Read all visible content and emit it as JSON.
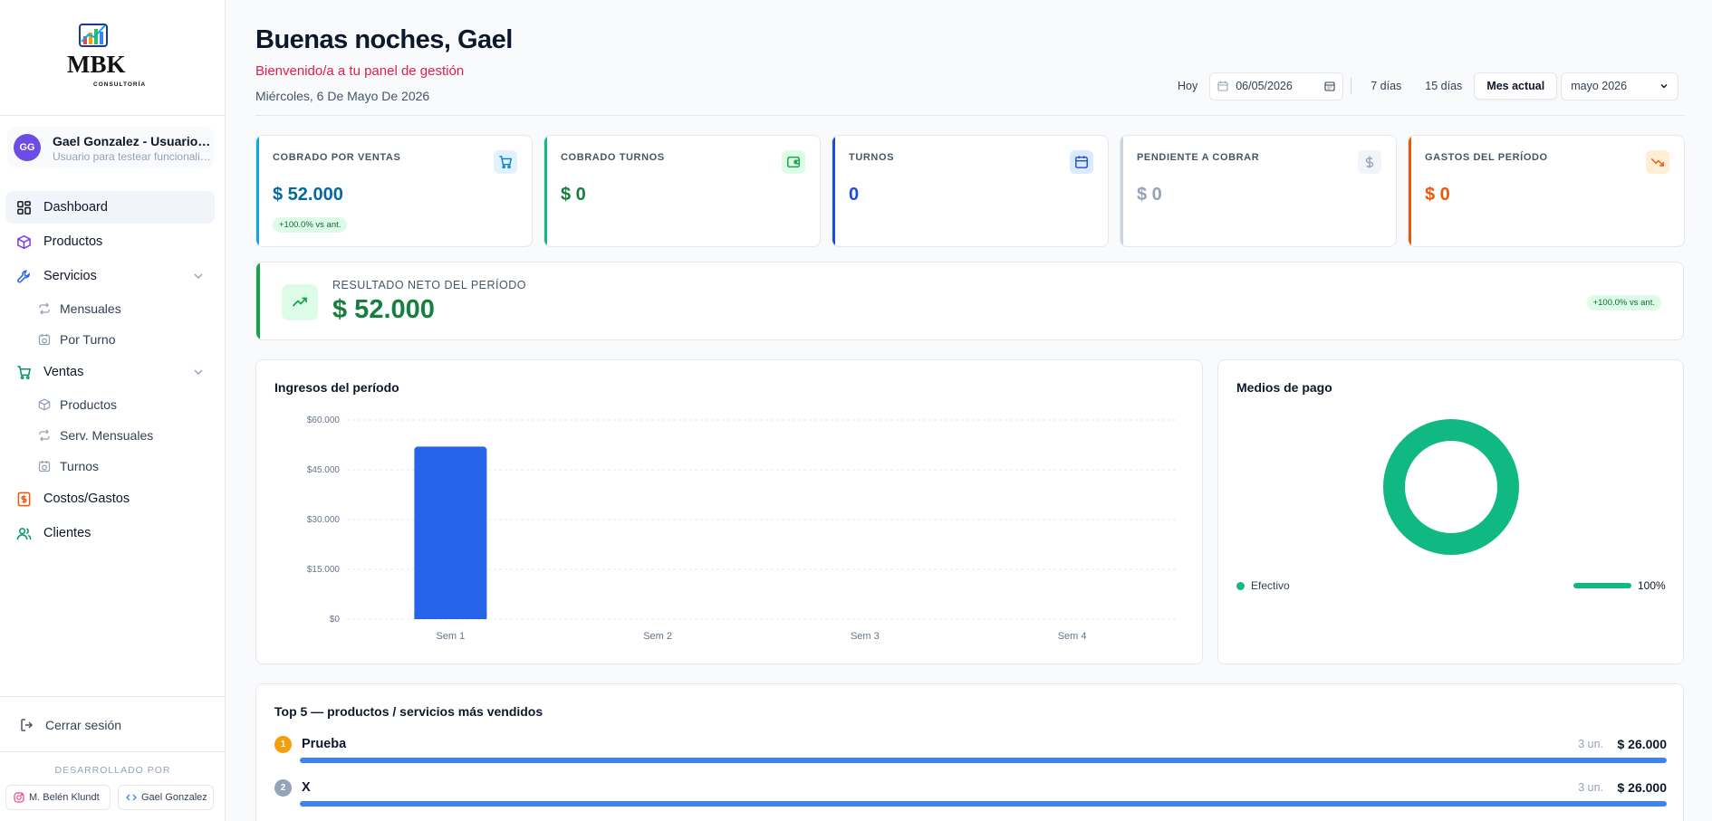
{
  "brand": {
    "logo_text": "MBK",
    "logo_sub": "CONSULTORÍA"
  },
  "user": {
    "initials": "GG",
    "name": "Gael Gonzalez - Usuario de prueba",
    "subtitle": "Usuario para testear funcionalidades"
  },
  "nav": {
    "dashboard": "Dashboard",
    "productos": "Productos",
    "servicios": "Servicios",
    "mensuales": "Mensuales",
    "por_turno": "Por Turno",
    "ventas": "Ventas",
    "ventas_productos": "Productos",
    "serv_mensuales": "Serv. Mensuales",
    "turnos": "Turnos",
    "costos": "Costos/Gastos",
    "clientes": "Clientes"
  },
  "footer": {
    "logout": "Cerrar sesión",
    "developed_by": "DESARROLLADO POR",
    "dev1": "M. Belén Klundt",
    "dev2": "Gael Gonzalez"
  },
  "header": {
    "greeting": "Buenas noches, Gael",
    "welcome": "Bienvenido/a a tu panel de gestión",
    "date": "Miércoles, 6 De Mayo De 2026"
  },
  "toolbar": {
    "hoy": "Hoy",
    "date_value": "06/05/2026",
    "d7": "7 días",
    "d15": "15 días",
    "mes_actual": "Mes actual",
    "month": "mayo 2026"
  },
  "kpis": [
    {
      "title": "COBRADO POR VENTAS",
      "value": "$ 52.000",
      "badge": "+100.0% vs ant.",
      "color": "#0369a1",
      "accent": "#0ea5e9"
    },
    {
      "title": "COBRADO TURNOS",
      "value": "$ 0",
      "color": "#15803d",
      "accent": "#10b981"
    },
    {
      "title": "TURNOS",
      "value": "0",
      "color": "#1d4ed8",
      "accent": "#1d4ed8"
    },
    {
      "title": "PENDIENTE A COBRAR",
      "value": "$ 0",
      "color": "#94a3b8",
      "accent": "#cbd5e1"
    },
    {
      "title": "GASTOS DEL PERÍODO",
      "value": "$ 0",
      "color": "#ea580c",
      "accent": "#ea580c"
    }
  ],
  "net": {
    "title": "RESULTADO NETO DEL PERÍODO",
    "value": "$ 52.000",
    "badge": "+100.0% vs ant."
  },
  "income_chart": {
    "title": "Ingresos del período"
  },
  "chart_data": {
    "type": "bar",
    "categories": [
      "Sem 1",
      "Sem 2",
      "Sem 3",
      "Sem 4"
    ],
    "values": [
      52000,
      0,
      0,
      0
    ],
    "ylim": [
      0,
      60000
    ],
    "yticks": [
      "$0",
      "$15.000",
      "$30.000",
      "$45.000",
      "$60.000"
    ],
    "ytick_values": [
      0,
      15000,
      30000,
      45000,
      60000
    ],
    "grid": true,
    "bar_color": "#2563eb"
  },
  "payments": {
    "title": "Medios de pago",
    "items": [
      {
        "name": "Efectivo",
        "pct": "100%",
        "share": 1.0,
        "color": "#10b981"
      }
    ]
  },
  "top": {
    "title": "Top 5 — productos / servicios más vendidos",
    "items": [
      {
        "rank": "1",
        "name": "Prueba",
        "qty": "3 un.",
        "amount": "$ 26.000",
        "share": 1.0,
        "rank_color": "#f59e0b"
      },
      {
        "rank": "2",
        "name": "X",
        "qty": "3 un.",
        "amount": "$ 26.000",
        "share": 1.0,
        "rank_color": "#94a3b8"
      }
    ]
  },
  "colors": {
    "accent": "#2563eb",
    "brand_red": "#e11d48",
    "success": "#16a34a"
  }
}
